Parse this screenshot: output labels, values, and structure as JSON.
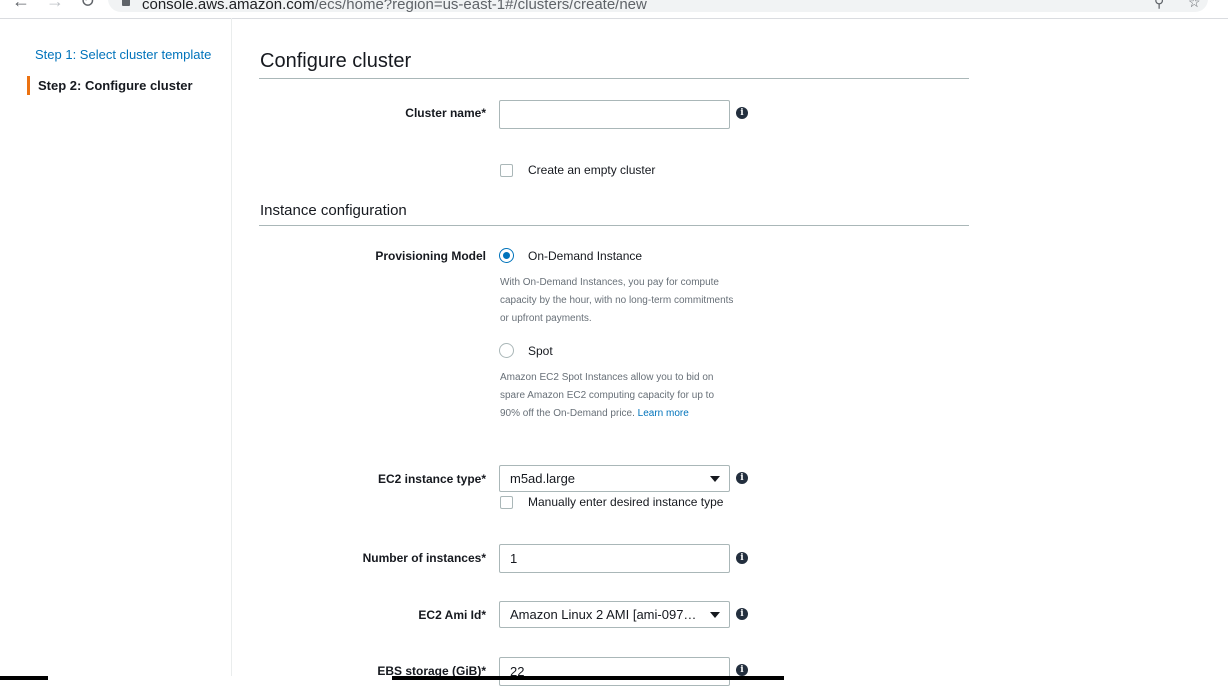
{
  "browser": {
    "url_host": "console.aws.amazon.com",
    "url_path": "/ecs/home?region=us-east-1#/clusters/create/new"
  },
  "sidebar": {
    "step1": "Step 1: Select cluster template",
    "step2": "Step 2: Configure cluster"
  },
  "main": {
    "title": "Configure cluster",
    "cluster_name": {
      "label": "Cluster name*",
      "value": ""
    },
    "empty_cluster_label": "Create an empty cluster",
    "instance_section_title": "Instance configuration",
    "provisioning": {
      "label": "Provisioning Model",
      "on_demand": {
        "label": "On-Demand Instance",
        "description": "With On-Demand Instances, you pay for compute capacity by the hour, with no long-term commitments or upfront payments."
      },
      "spot": {
        "label": "Spot",
        "description": "Amazon EC2 Spot Instances allow you to bid on spare Amazon EC2 computing capacity for up to 90% off the On-Demand price.",
        "learn_more": "Learn more"
      }
    },
    "instance_type": {
      "label": "EC2 instance type*",
      "value": "m5ad.large",
      "manual_label": "Manually enter desired instance type"
    },
    "num_instances": {
      "label": "Number of instances*",
      "value": "1"
    },
    "ami": {
      "label": "EC2 Ami Id*",
      "value": "Amazon Linux 2 AMI [ami-097e3..."
    },
    "ebs": {
      "label": "EBS storage (GiB)*",
      "value": "22"
    }
  },
  "colors": {
    "link": "#0073bb",
    "accent": "#ec7211",
    "rule": "#aab7b8"
  }
}
